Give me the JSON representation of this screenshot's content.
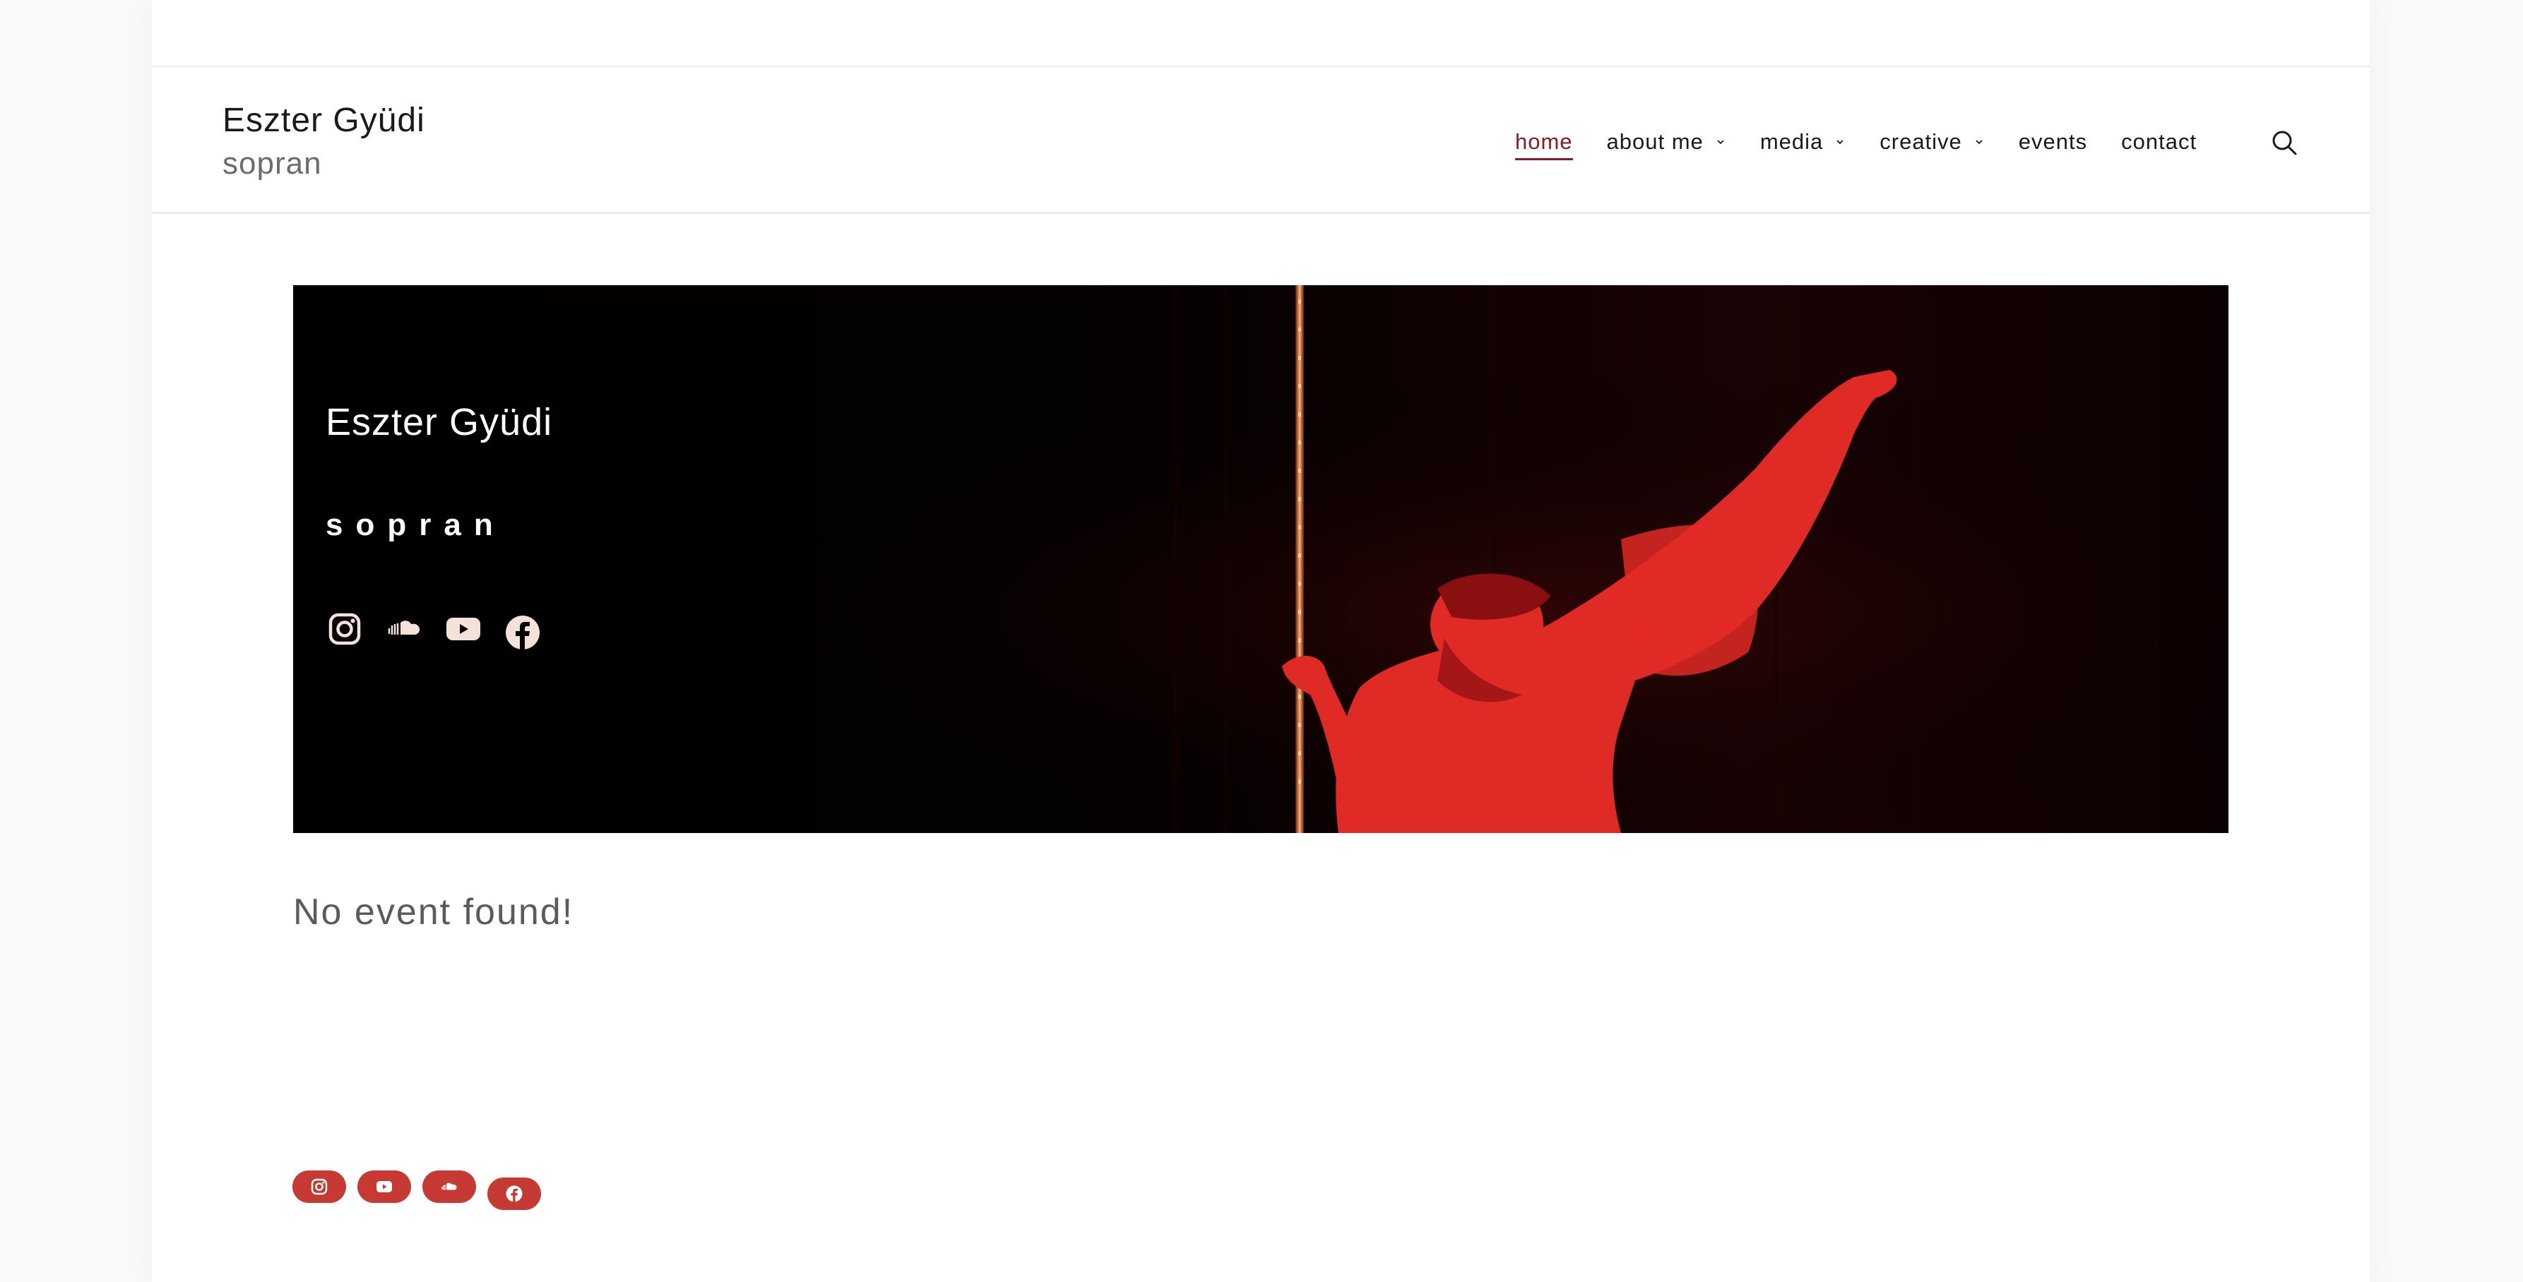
{
  "site": {
    "title": "Eszter Gyüdi",
    "subtitle": "sopran"
  },
  "nav": {
    "items": [
      {
        "label": "home",
        "active": true,
        "dropdown": false
      },
      {
        "label": "about me",
        "active": false,
        "dropdown": true
      },
      {
        "label": "media",
        "active": false,
        "dropdown": true
      },
      {
        "label": "creative",
        "active": false,
        "dropdown": true
      },
      {
        "label": "events",
        "active": false,
        "dropdown": false
      },
      {
        "label": "contact",
        "active": false,
        "dropdown": false
      }
    ],
    "search_icon": "search-icon"
  },
  "hero": {
    "title": "Eszter Gyüdi",
    "subtitle": "sopran",
    "icons": [
      "instagram-icon",
      "soundcloud-icon",
      "youtube-icon",
      "facebook-icon"
    ]
  },
  "main": {
    "empty_message": "No event found!"
  },
  "footer": {
    "social": [
      "instagram-icon",
      "youtube-icon",
      "soundcloud-icon",
      "facebook-icon"
    ]
  },
  "colors": {
    "accent": "#8b1a24",
    "social_pill": "#c73a34",
    "hero_bg": "#000000",
    "hero_red": "#e02a26"
  }
}
